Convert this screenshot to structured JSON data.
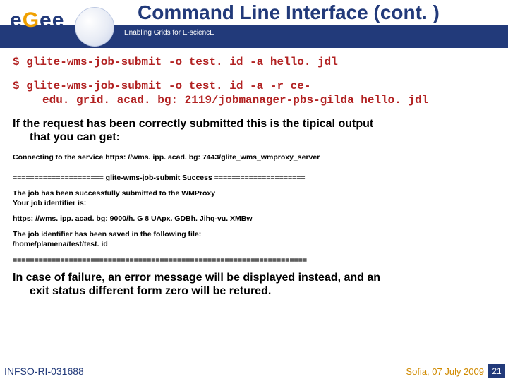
{
  "header": {
    "logo_letters": {
      "e1": "e",
      "g": "G",
      "e2": "e",
      "e3": "e"
    },
    "tagline": "Enabling Grids for E-sciencE",
    "title": "Command Line Interface (cont. )"
  },
  "commands": {
    "cmd1": "$ glite-wms-job-submit -o test. id -a hello. jdl",
    "cmd2_line1": "$ glite-wms-job-submit -o test. id -a -r ce-",
    "cmd2_line2": "edu. grid. acad. bg: 2119/jobmanager-pbs-gilda hello. jdl"
  },
  "body": {
    "intro_line1": "If the request has been correctly submitted this is the tipical output",
    "intro_line2": "that you can get:",
    "connect": "Connecting to the service https: //wms. ipp. acad. bg: 7443/glite_wms_wmproxy_server",
    "success_sep": "===================== glite-wms-job-submit Success =====================",
    "submitted1": "The job has been successfully submitted to the WMProxy",
    "submitted2": "Your job identifier is:",
    "jobid": "https: //wms. ipp. acad. bg: 9000/h. G 8 UApx. GDBh. Jihq-vu. XMBw",
    "saved1": "The job identifier has been saved in the following file:",
    "saved2": "/home/plamena/test/test. id",
    "dashsep": "====================================================================",
    "failure_line1": "In case of failure, an error message will be displayed instead, and an",
    "failure_line2": "exit status different form zero will be retured."
  },
  "footer": {
    "left": "INFSO-RI-031688",
    "right": "Sofia, 07 July 2009",
    "page": "21"
  }
}
